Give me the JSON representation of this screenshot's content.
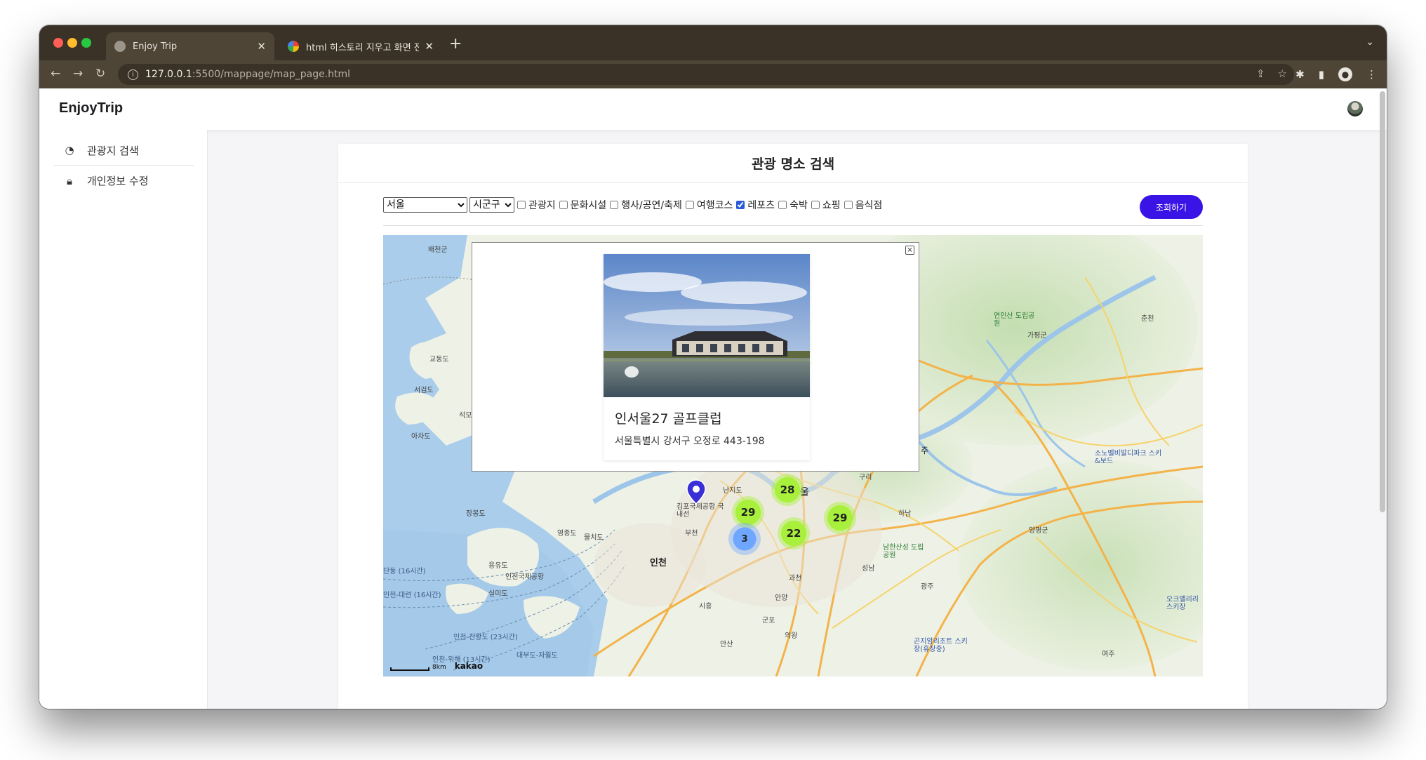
{
  "browser": {
    "tabs": [
      {
        "title": "Enjoy Trip",
        "active": true
      },
      {
        "title": "html 히스토리 지우고 화면 전환 - G",
        "active": false
      }
    ],
    "url_host": "127.0.0.1",
    "url_path": ":5500/mappage/map_page.html"
  },
  "header": {
    "brand": "EnjoyTrip"
  },
  "sidebar": {
    "items": [
      {
        "label": "관광지 검색",
        "icon": "dashboard-icon"
      },
      {
        "label": "개인정보 수정",
        "icon": "lock-icon"
      }
    ]
  },
  "main": {
    "title": "관광 명소 검색",
    "filters": {
      "city_selected": "서울",
      "district_selected": "시군구",
      "categories": [
        {
          "label": "관광지",
          "checked": false
        },
        {
          "label": "문화시설",
          "checked": false
        },
        {
          "label": "행사/공연/축제",
          "checked": false
        },
        {
          "label": "여행코스",
          "checked": false
        },
        {
          "label": "레포츠",
          "checked": true
        },
        {
          "label": "숙박",
          "checked": false
        },
        {
          "label": "쇼핑",
          "checked": false
        },
        {
          "label": "음식점",
          "checked": false
        }
      ],
      "search_label": "조회하기"
    },
    "popup": {
      "close_label": "×",
      "place_name": "인서울27 골프클럽",
      "place_address": "서울특별시 강서구 오정로 443-198"
    },
    "map": {
      "clusters": [
        {
          "count": "28",
          "color": "green"
        },
        {
          "count": "29",
          "color": "green"
        },
        {
          "count": "29",
          "color": "green"
        },
        {
          "count": "22",
          "color": "green"
        },
        {
          "count": "3",
          "color": "blue"
        }
      ],
      "labels": {
        "baecheon": "배천군",
        "gyodong": "교동도",
        "seogeom": "서검도",
        "seok": "석모",
        "ajudo": "아차도",
        "jangbong": "장봉도",
        "yeongjong": "영종도",
        "mulchi": "물치도",
        "yongyu": "용유도",
        "incheon_airport": "인천국제공항",
        "silmi": "실미도",
        "incheon": "인천",
        "bucheon": "부천",
        "gimpo_airport": "김포국제공항 국내선",
        "nanji": "난지도",
        "guri": "구리",
        "hanam": "하남",
        "seongnam": "성남",
        "gwacheon": "과천",
        "anyang": "안양",
        "siheung": "시흥",
        "gunpo": "군포",
        "uiwang": "의왕",
        "ansan": "안산",
        "gwangju": "광주",
        "yeoju": "여주",
        "yangpyeong": "양평군",
        "chuncheon": "춘천",
        "gapyeong": "가평군",
        "yeonin": "연인산 도립공원",
        "namhansanseong": "남한산성 도립공원",
        "sono": "소노벨비발디파크 스키&보드",
        "konjiam": "곤지암리조트 스키장(휴장중)",
        "oak": "오크밸리리 스키장",
        "dandong": "단동 (16시간)",
        "daeyeon": "인천-대련 (16시간)",
        "jindo": "인천-진왕도 (23시간)",
        "wihae": "인천-위해 (13시간)",
        "daebu": "대부도-자월도",
        "jul": "주",
        "ul": "울",
        "scale": "8km",
        "logo": "kakao"
      }
    }
  }
}
